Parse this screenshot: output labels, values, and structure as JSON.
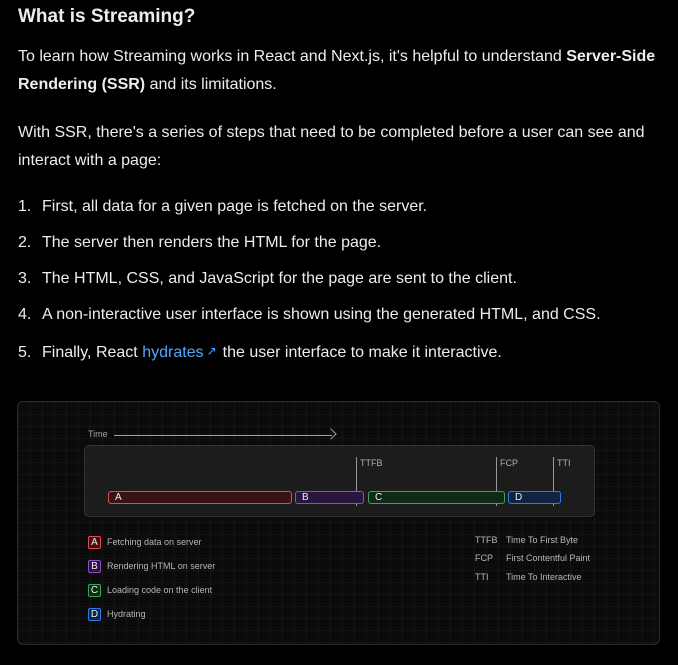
{
  "heading": "What is Streaming?",
  "intro": {
    "text_before": "To learn how Streaming works in React and Next.js, it's helpful to understand ",
    "bold": "Server-Side Rendering (SSR)",
    "text_after": " and its limitations."
  },
  "ssr_paragraph": "With SSR, there's a series of steps that need to be completed before a user can see and interact with a page:",
  "steps": [
    {
      "num": "1.",
      "text": "First, all data for a given page is fetched on the server."
    },
    {
      "num": "2.",
      "text": "The server then renders the HTML for the page."
    },
    {
      "num": "3.",
      "text": "The HTML, CSS, and JavaScript for the page are sent to the client."
    },
    {
      "num": "4.",
      "text": "A non-interactive user interface is shown using the generated HTML, and CSS."
    },
    {
      "num": "5.",
      "text_before": "Finally, React ",
      "link": "hydrates",
      "link_icon": "external-link-icon",
      "text_after": "the user interface to make it interactive."
    }
  ],
  "diagram": {
    "time_label": "Time",
    "markers": [
      {
        "label": "TTFB"
      },
      {
        "label": "FCP"
      },
      {
        "label": "TTI"
      }
    ],
    "bars": [
      {
        "label": "A",
        "color": "#e5484d"
      },
      {
        "label": "B",
        "color": "#8e4ec6"
      },
      {
        "label": "C",
        "color": "#3aa655"
      },
      {
        "label": "D",
        "color": "#2f7be6"
      }
    ],
    "legend": [
      {
        "key": "A",
        "text": "Fetching data on server"
      },
      {
        "key": "B",
        "text": "Rendering HTML on server"
      },
      {
        "key": "C",
        "text": "Loading code on the client"
      },
      {
        "key": "D",
        "text": "Hydrating"
      }
    ],
    "abbreviations": [
      {
        "key": "TTFB",
        "text": "Time To First Byte"
      },
      {
        "key": "FCP",
        "text": "First Contentful Paint"
      },
      {
        "key": "TTI",
        "text": "Time To Interactive"
      }
    ]
  },
  "colors": {
    "background": "#000000",
    "text": "#ededed",
    "link": "#52a8ff"
  }
}
